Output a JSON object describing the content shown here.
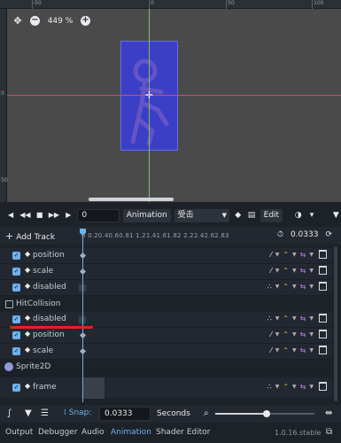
{
  "viewport": {
    "ruler_labels_top": [
      "-50",
      "0",
      "50",
      "100"
    ],
    "ruler_labels_left": [
      "0",
      "50"
    ],
    "zoom": "449 %"
  },
  "toolbar": {
    "frame_value": "0",
    "animation_label": "Animation",
    "animation_name": "受击",
    "edit_label": "Edit"
  },
  "track_header": {
    "add_track_label": "Add Track",
    "timeline_ticks": "0  0.20.40.60.81  1.21.41.61.82  2.22.42.62.83",
    "length_value": "0.0333"
  },
  "tracks": [
    {
      "kind": "track",
      "name": "position"
    },
    {
      "kind": "track",
      "name": "scale"
    },
    {
      "kind": "track",
      "name": "disabled"
    },
    {
      "kind": "group",
      "name": "HitCollision"
    },
    {
      "kind": "track",
      "name": "disabled"
    },
    {
      "kind": "track",
      "name": "position"
    },
    {
      "kind": "track",
      "name": "scale"
    },
    {
      "kind": "group",
      "name": "Sprite2D"
    },
    {
      "kind": "track",
      "name": "frame"
    }
  ],
  "bottom": {
    "snap_label": "Snap:",
    "snap_value": "0.0333",
    "unit": "Seconds",
    "zoom_level": 0.52
  },
  "panel_tabs": [
    "Output",
    "Debugger",
    "Audio",
    "Animation",
    "Shader Editor"
  ],
  "active_tab": "Animation",
  "version": "1.0.16.stable",
  "colors": {
    "accent": "#6cb1f0",
    "sprite_fill": "#3a3fd0",
    "annotation": "#e0241c",
    "curve_yellow": "#e8c24a",
    "loop_purple": "#c07ee8"
  }
}
